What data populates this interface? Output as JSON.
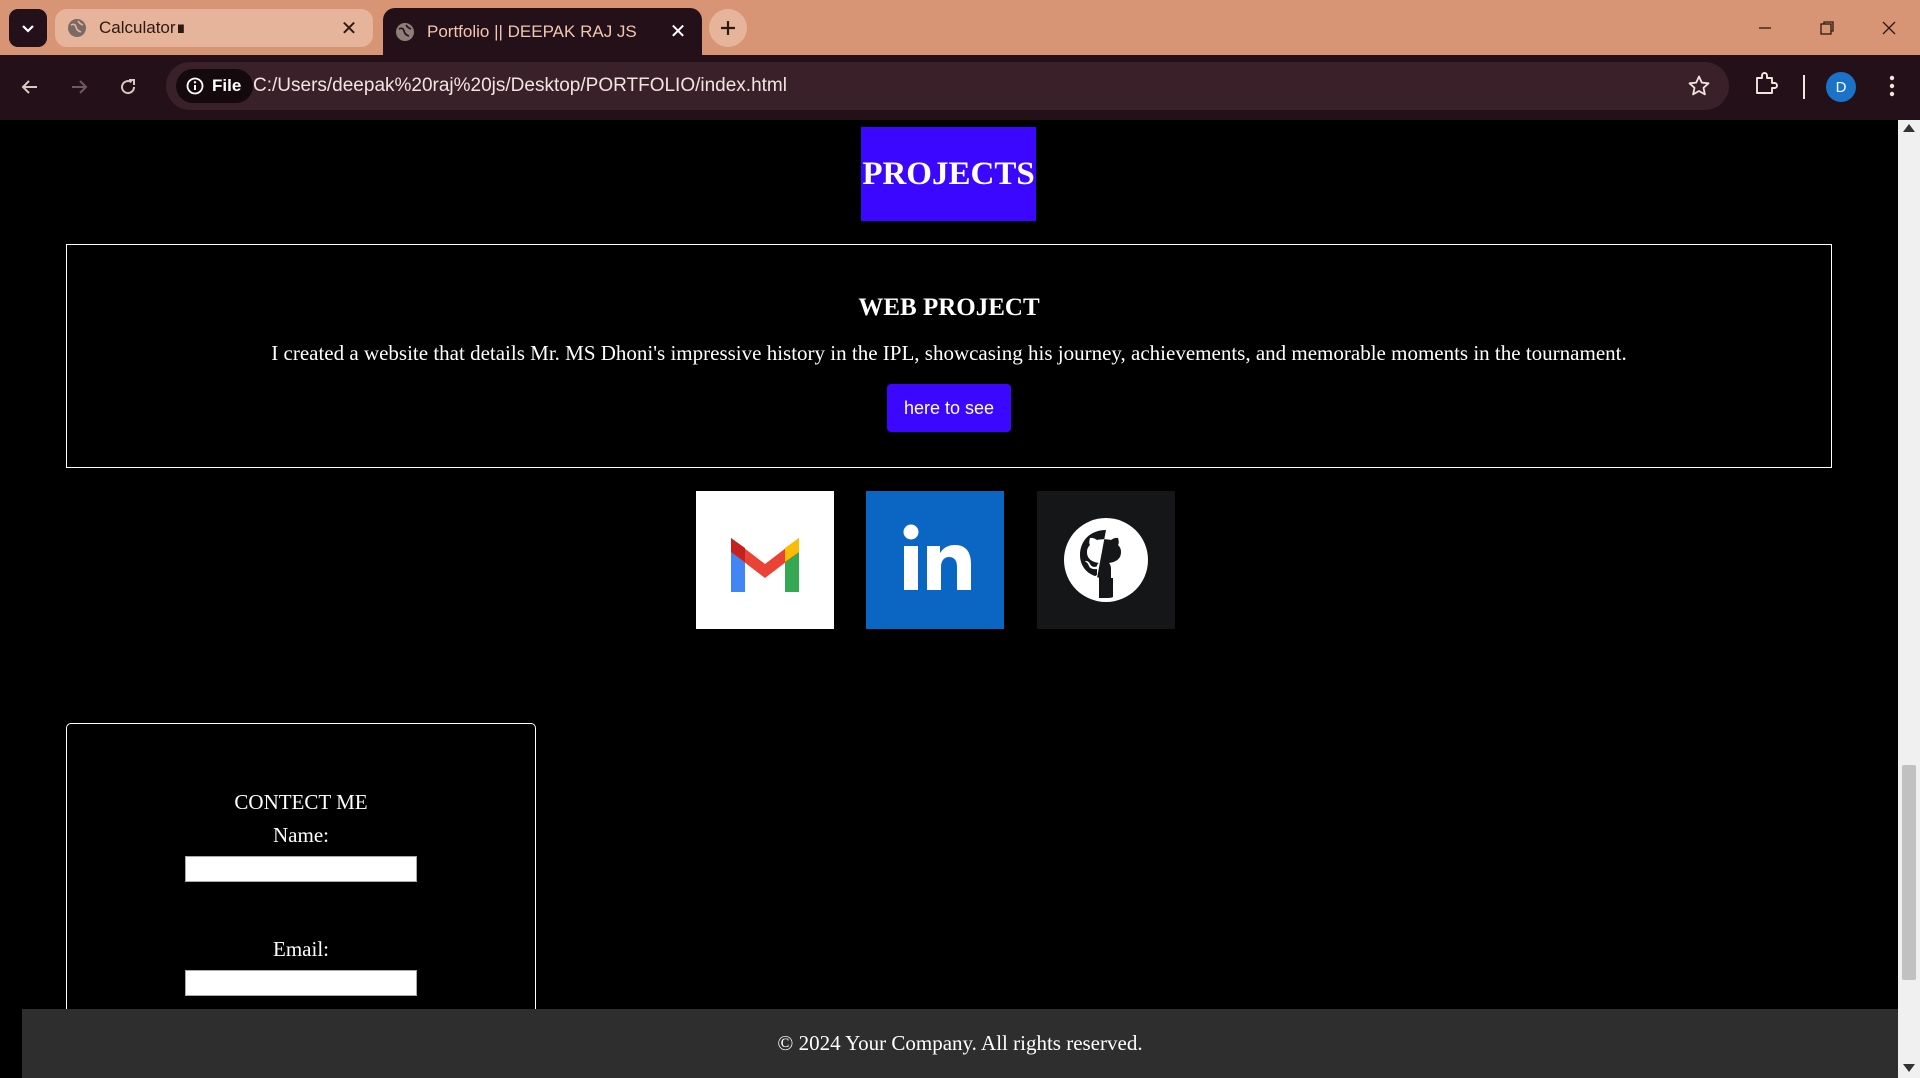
{
  "browser": {
    "tabs": [
      {
        "title": "Calculator∎",
        "active": false
      },
      {
        "title": "Portfolio || DEEPAK RAJ JS",
        "active": true
      }
    ],
    "security_chip": "File",
    "url": "C:/Users/deepak%20raj%20js/Desktop/PORTFOLIO/index.html",
    "profile_initial": "D"
  },
  "page": {
    "projects_heading": "PROJECTS",
    "project": {
      "title": "WEB PROJECT",
      "description": "I created a website that details Mr. MS Dhoni's impressive history in the IPL, showcasing his journey, achievements, and memorable moments in the tournament.",
      "button_label": "here to see"
    },
    "social_links": [
      "gmail-icon",
      "linkedin-icon",
      "github-icon"
    ],
    "contact": {
      "title": "CONTECT ME",
      "name_label": "Name:",
      "email_label": "Email:",
      "name_value": "",
      "email_value": ""
    },
    "footer": "© 2024 Your Company. All rights reserved."
  },
  "colors": {
    "accent": "#3b07ff",
    "tabbar": "#d89576",
    "toolbar": "#241018",
    "page_bg": "#000000",
    "footer_bg": "#2e2e2e"
  }
}
